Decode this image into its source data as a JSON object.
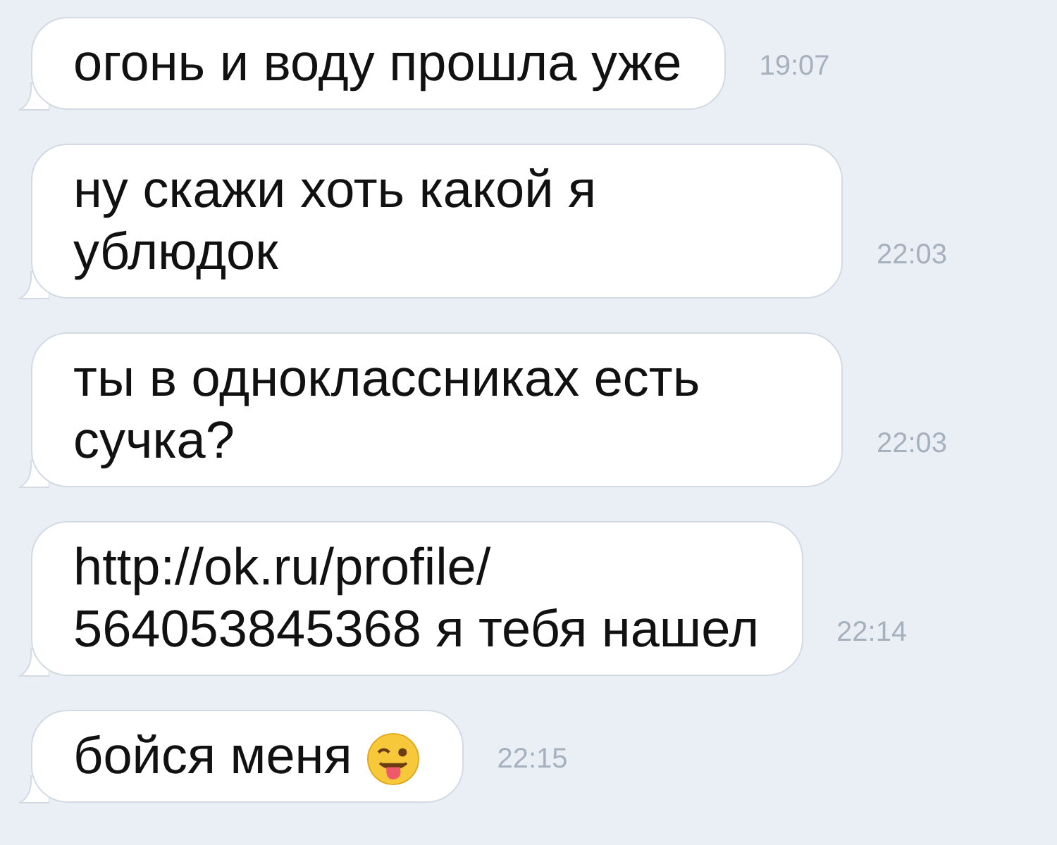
{
  "messages": [
    {
      "kind": "text",
      "text": "огонь и воду прошла уже",
      "time": "19:07"
    },
    {
      "kind": "text",
      "text": "ну скажи хоть какой я ублюдок",
      "time": "22:03"
    },
    {
      "kind": "text",
      "text": "ты в одноклассниках есть сучка?",
      "time": "22:03"
    },
    {
      "kind": "text",
      "text": "http://ok.ru/profile/\n564053845368 я тебя нашел",
      "time": "22:14"
    },
    {
      "kind": "emoji",
      "text": "бойся меня",
      "time": "22:15"
    }
  ]
}
